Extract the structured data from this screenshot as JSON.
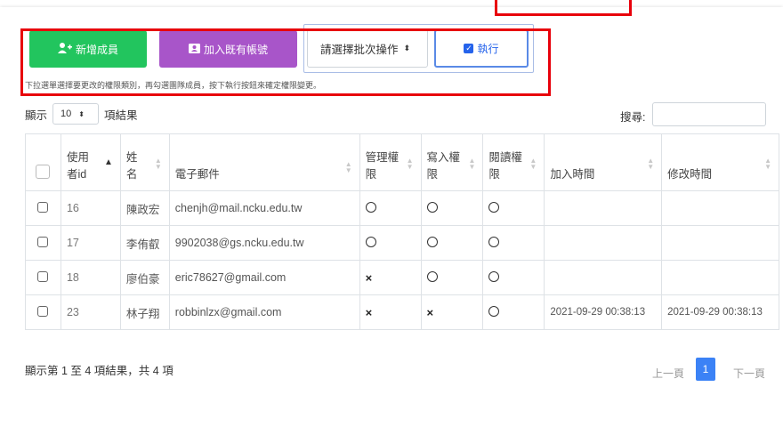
{
  "toolbar": {
    "add_member_label": "新增成員",
    "join_existing_label": "加入既有帳號",
    "batch_select_value": "請選擇批次操作",
    "run_label": "執行",
    "hint": "下拉選單選擇要更改的權限類別，再勾選團隊成員，按下執行按鈕來確定權限變更。"
  },
  "length": {
    "prefix": "顯示",
    "value": "10",
    "suffix": "項結果"
  },
  "search": {
    "label": "搜尋:"
  },
  "table": {
    "headers": [
      "使用者id",
      "姓名",
      "電子郵件",
      "管理權限",
      "寫入權限",
      "閱讀權限",
      "加入時間",
      "修改時間"
    ],
    "header_lines": [
      [
        "使用",
        "者id"
      ],
      [
        "姓",
        "名"
      ],
      [
        "電子郵件"
      ],
      [
        "管理權",
        "限"
      ],
      [
        "寫入權",
        "限"
      ],
      [
        "閱讀權",
        "限"
      ],
      [
        "加入時間"
      ],
      [
        "修改時間"
      ]
    ],
    "rows": [
      {
        "id": "16",
        "name": "陳政宏",
        "email": "chenjh@mail.ncku.edu.tw",
        "admin": "○",
        "write": "○",
        "read": "○",
        "joined": "",
        "modified": ""
      },
      {
        "id": "17",
        "name": "李侑叡",
        "email": "9902038@gs.ncku.edu.tw",
        "admin": "○",
        "write": "○",
        "read": "○",
        "joined": "",
        "modified": ""
      },
      {
        "id": "18",
        "name": "廖伯豪",
        "email": "eric78627@gmail.com",
        "admin": "×",
        "write": "○",
        "read": "○",
        "joined": "",
        "modified": ""
      },
      {
        "id": "23",
        "name": "林子翔",
        "email": "robbinlzx@gmail.com",
        "admin": "×",
        "write": "×",
        "read": "○",
        "joined": "2021-09-29 00:38:13",
        "modified": "2021-09-29 00:38:13"
      }
    ]
  },
  "footer": {
    "summary": "顯示第 1 至 4 項結果，共 4 項",
    "prev": "上一頁",
    "current": "1",
    "next": "下一頁"
  }
}
